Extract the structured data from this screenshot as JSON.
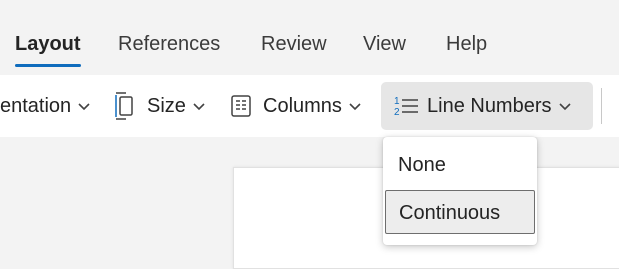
{
  "ribbon": {
    "tabs": [
      {
        "label": "Layout",
        "active": true
      },
      {
        "label": "References",
        "active": false
      },
      {
        "label": "Review",
        "active": false
      },
      {
        "label": "View",
        "active": false
      },
      {
        "label": "Help",
        "active": false
      }
    ]
  },
  "toolbar": {
    "orientation_label": "entation",
    "size_label": "Size",
    "columns_label": "Columns",
    "line_numbers_label": "Line Numbers",
    "icons": [
      "chevron-down-icon",
      "page-size-icon",
      "columns-icon",
      "line-numbers-icon"
    ]
  },
  "line_numbers_menu": {
    "items": [
      {
        "label": "None",
        "selected": false
      },
      {
        "label": "Continuous",
        "selected": true
      }
    ]
  },
  "colors": {
    "accent": "#0f6cbd",
    "ribbon_bg": "#f3f3f3",
    "toolbar_bg": "#ffffff",
    "pressed_bg": "#e6e6e6"
  }
}
